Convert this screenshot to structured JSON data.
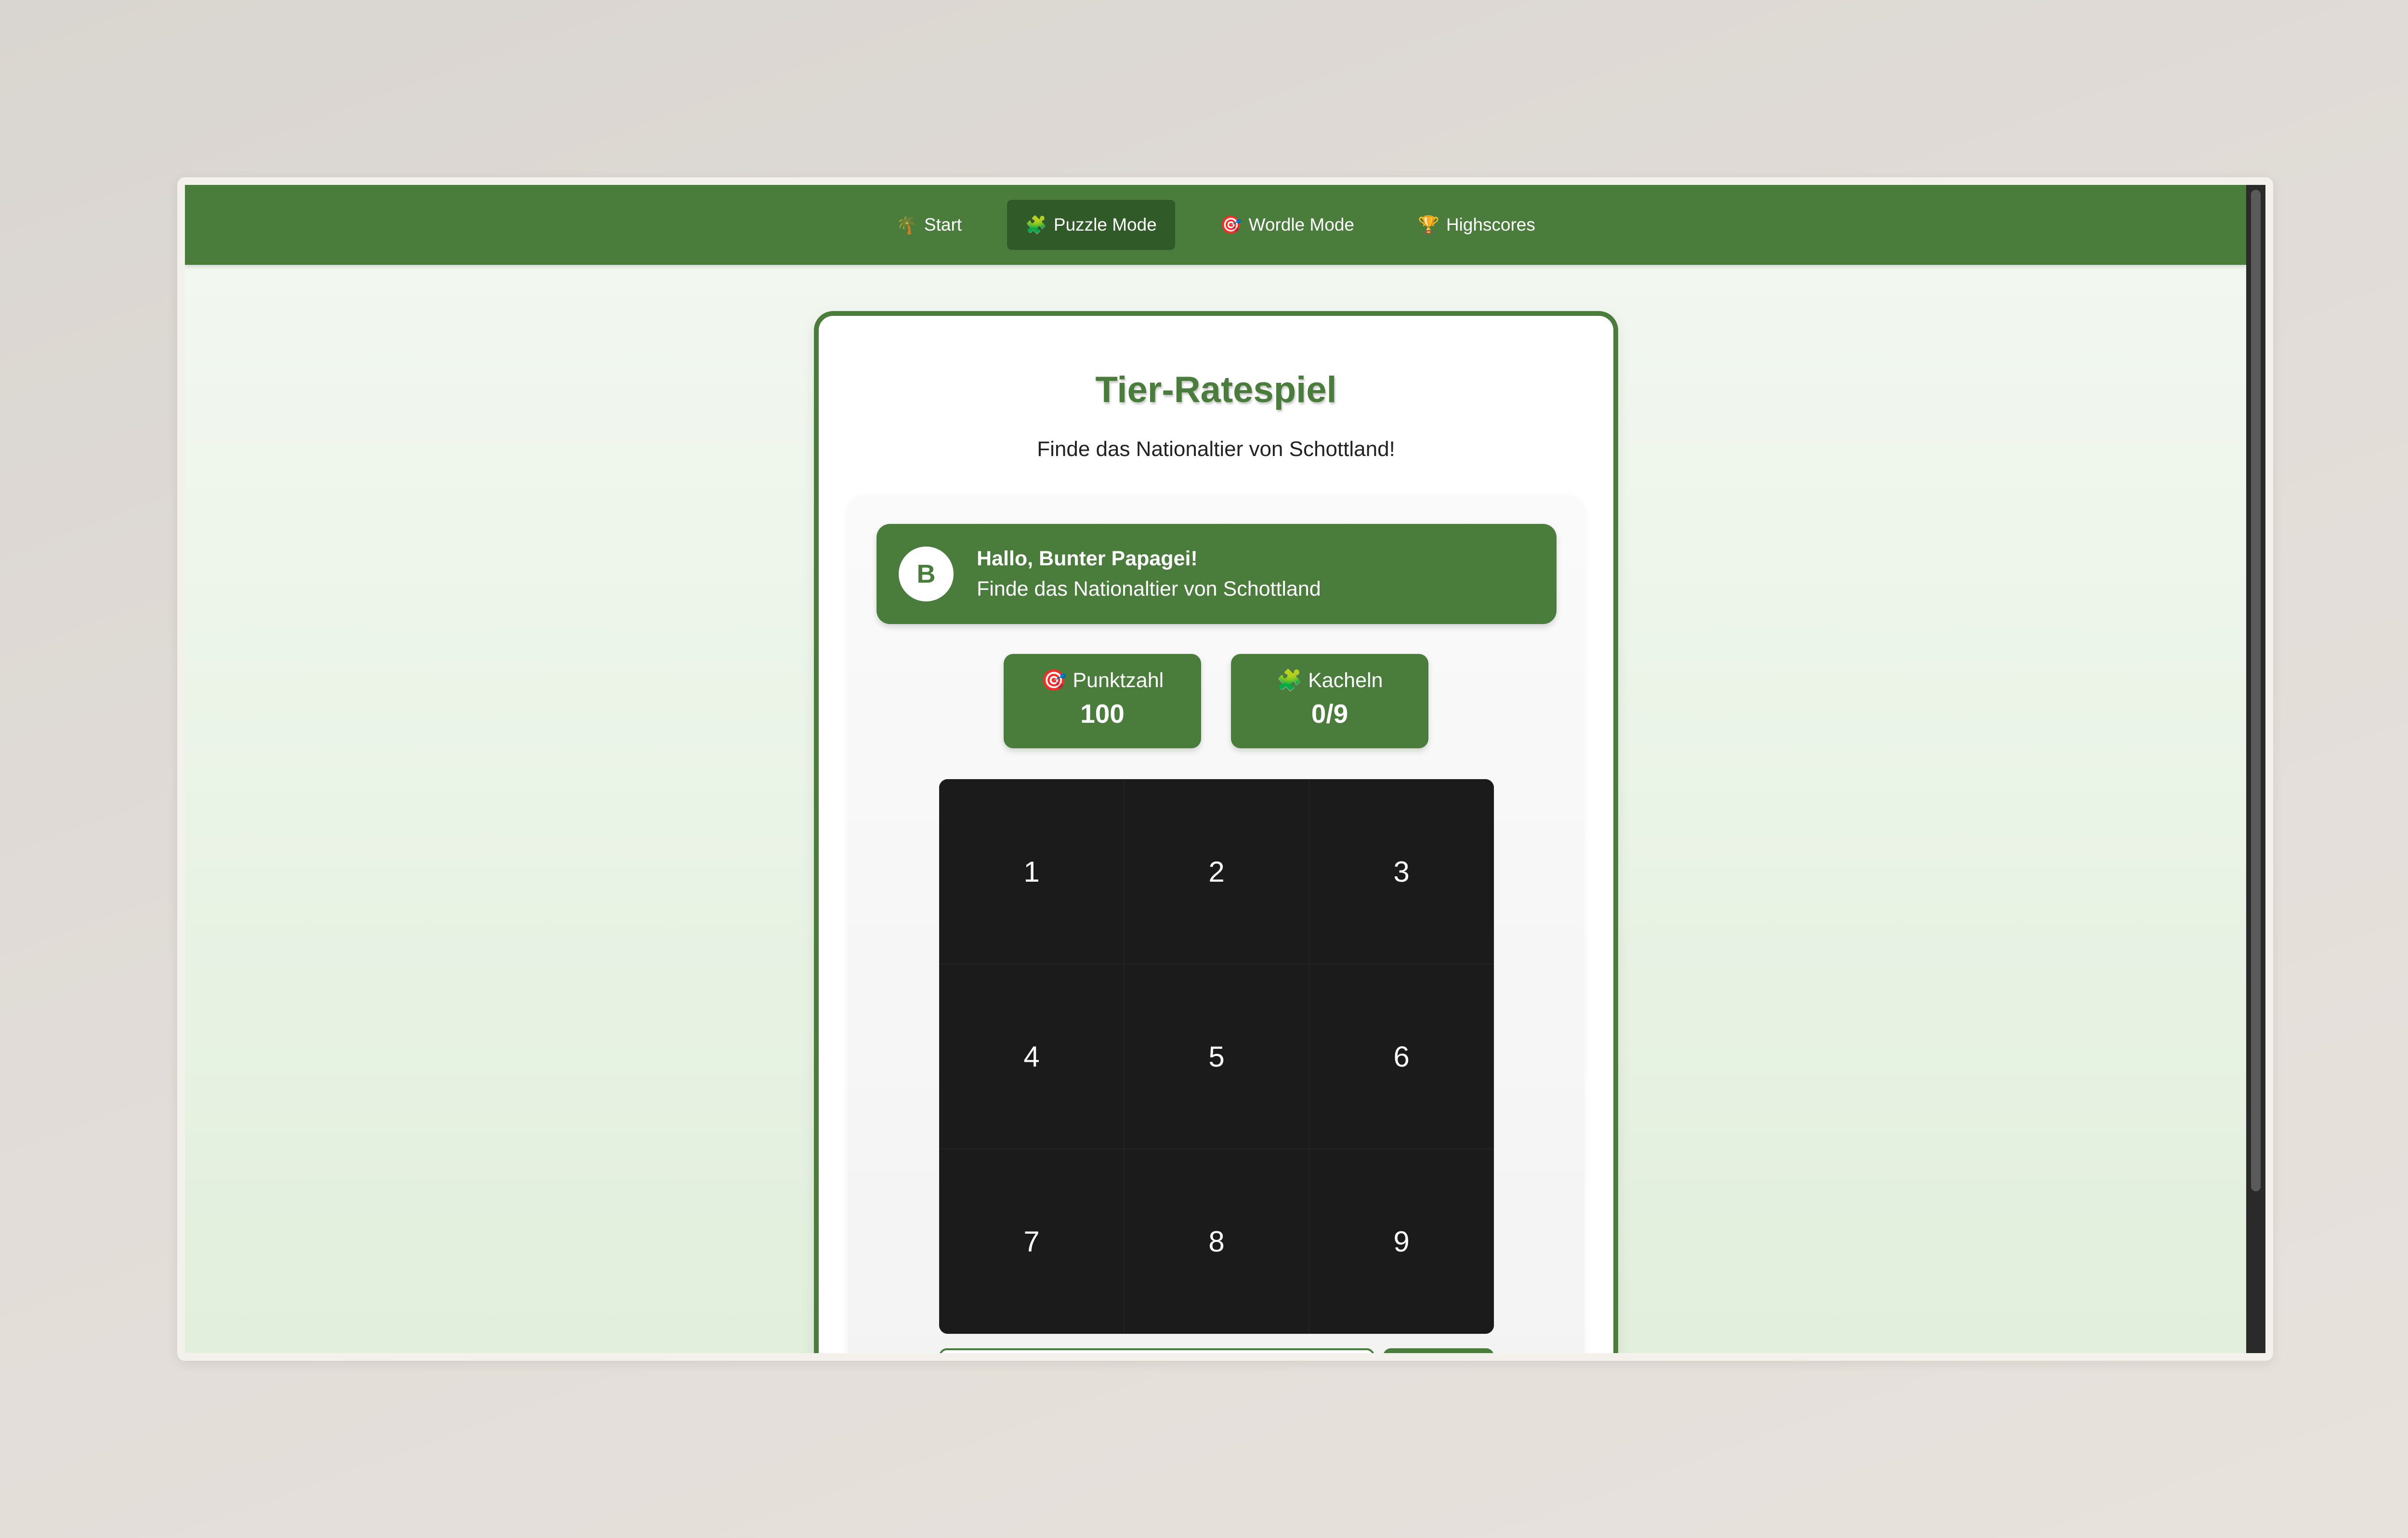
{
  "nav": {
    "items": [
      {
        "icon": "palm-tree-icon",
        "glyph": "🌴",
        "label": "Start",
        "active": false
      },
      {
        "icon": "puzzle-piece-icon",
        "glyph": "🧩",
        "label": "Puzzle Mode",
        "active": true
      },
      {
        "icon": "target-icon",
        "glyph": "🎯",
        "label": "Wordle Mode",
        "active": false
      },
      {
        "icon": "trophy-icon",
        "glyph": "🏆",
        "label": "Highscores",
        "active": false
      }
    ]
  },
  "game": {
    "title": "Tier-Ratespiel",
    "subtitle": "Finde das Nationaltier von Schottland!"
  },
  "player": {
    "avatar_letter": "B",
    "greeting": "Hallo, Bunter Papagei!",
    "task": "Finde das Nationaltier von Schottland"
  },
  "stats": {
    "score": {
      "icon": "target-icon",
      "glyph": "🎯",
      "label": "Punktzahl",
      "value": "100"
    },
    "tiles": {
      "icon": "puzzle-piece-icon",
      "glyph": "🧩",
      "label": "Kacheln",
      "value": "0/9"
    }
  },
  "grid": {
    "tiles": [
      "1",
      "2",
      "3",
      "4",
      "5",
      "6",
      "7",
      "8",
      "9"
    ]
  },
  "colors": {
    "primary": "#4a7c3c",
    "nav_active": "#305a27",
    "tile_bg": "#1b1b1b"
  }
}
